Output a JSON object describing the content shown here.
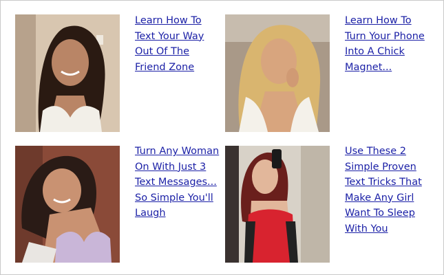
{
  "ads": [
    {
      "headline": "Learn How To Text Your Way Out Of The Friend Zone",
      "colors": {
        "background": "#d8c6b0",
        "hair": "#2a1a12",
        "skin": "#b98566",
        "clothing": "#f2efe8"
      }
    },
    {
      "headline": "Learn How To Turn Your Phone Into A Chick Magnet...",
      "colors": {
        "background": "#a99988",
        "hair": "#d9b56f",
        "skin": "#d8a57e",
        "clothing": "#f4f1ea"
      }
    },
    {
      "headline": "Turn Any Woman On With Just 3 Text Messages... So Simple You'll Laugh",
      "colors": {
        "background": "#8a4a38",
        "hair": "#2a1b16",
        "skin": "#c99272",
        "clothing": "#c9b6d8"
      }
    },
    {
      "headline": "Use These 2 Simple Proven Text Tricks That Make Any Girl Want To Sleep With You",
      "colors": {
        "background": "#d8d2c8",
        "hair": "#6a1f1c",
        "skin": "#e2b79b",
        "clothing": "#d8232f"
      }
    }
  ],
  "link_color": "#1a1fa6"
}
